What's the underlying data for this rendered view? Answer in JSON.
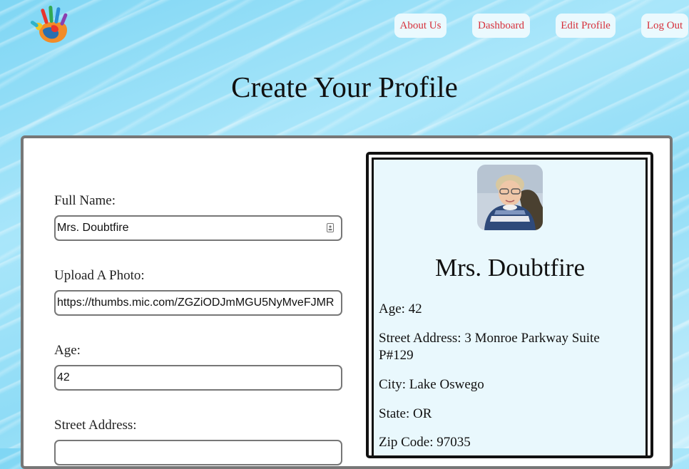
{
  "logo": {
    "icon": "colorful-hand-logo-icon"
  },
  "nav": {
    "about": "About Us",
    "dashboard": "Dashboard",
    "edit_profile": "Edit Profile",
    "logout": "Log Out",
    "color": "#d6303a"
  },
  "page": {
    "title": "Create Your Profile"
  },
  "form": {
    "full_name": {
      "label": "Full Name:",
      "value": "Mrs. Doubtfire"
    },
    "photo": {
      "label": "Upload A Photo:",
      "value": "https://thumbs.mic.com/ZGZiODJmMGU5NyMveFJMR"
    },
    "age": {
      "label": "Age:",
      "value": "42"
    },
    "street": {
      "label": "Street Address:"
    }
  },
  "preview": {
    "name": "Mrs. Doubtfire",
    "age": "Age: 42",
    "street": "Street Address: 3 Monroe Parkway Suite P#129",
    "city": "City: Lake Oswego",
    "state": "State: OR",
    "zip": "Zip Code: 97035"
  }
}
